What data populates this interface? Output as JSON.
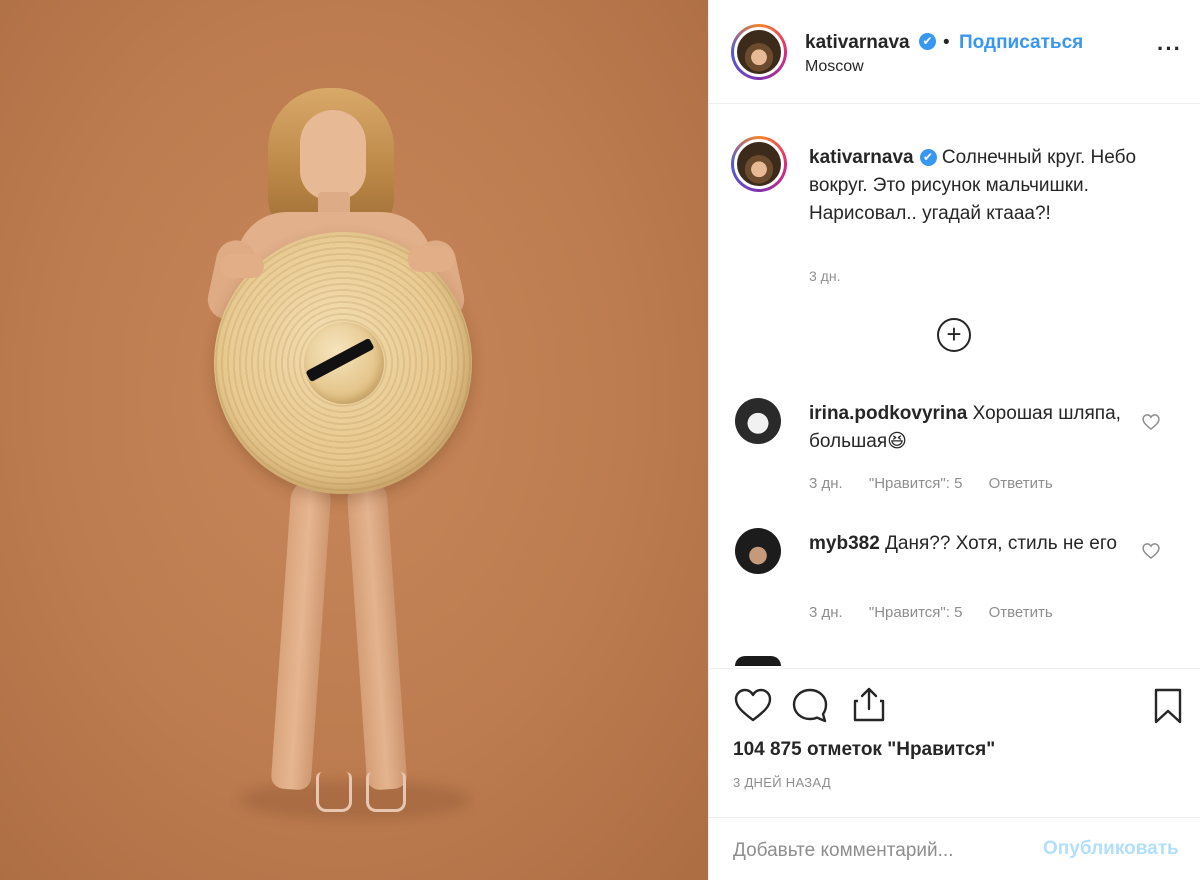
{
  "post": {
    "photo_alt": "",
    "background_color": "#bd7c4f"
  },
  "header": {
    "username": "kativarnava",
    "verified_mark": "✔",
    "separator": "•",
    "follow_label": "Подписаться",
    "location": "Moscow",
    "more_label": "···"
  },
  "caption": {
    "username": "kativarnava",
    "verified_mark": "✔",
    "text": "Солнечный круг. Небо вокруг. Это рисунок мальчишки. Нарисовал.. угадай ктааа?!",
    "time": "3 дн."
  },
  "load_more_label": "+",
  "comments": [
    {
      "username": "irina.podkovyrina",
      "text": "Хорошая шляпа, большая😆",
      "time": "3 дн.",
      "likes": "\"Нравится\": 5",
      "reply_label": "Ответить"
    },
    {
      "username": "myb382",
      "text": "Даня?? Хотя, стиль не его",
      "time": "3 дн.",
      "likes": "\"Нравится\": 5",
      "reply_label": "Ответить"
    }
  ],
  "actions": {
    "likes_text": "104 875 отметок \"Нравится\"",
    "posted_text": "3 ДНЕЙ НАЗАД"
  },
  "add_comment": {
    "placeholder": "Добавьте комментарий...",
    "publish_label": "Опубликовать"
  },
  "icons": {
    "like": "heart-icon",
    "comment": "comment-bubble-icon",
    "share": "share-icon",
    "bookmark": "bookmark-icon",
    "more": "more-options-icon",
    "verified": "verified-badge-icon",
    "load_more": "plus-circle-icon"
  },
  "colors": {
    "accent": "#3897f0",
    "publish_disabled": "#b2dffc",
    "muted": "#8e8e8e",
    "text": "#262626"
  }
}
